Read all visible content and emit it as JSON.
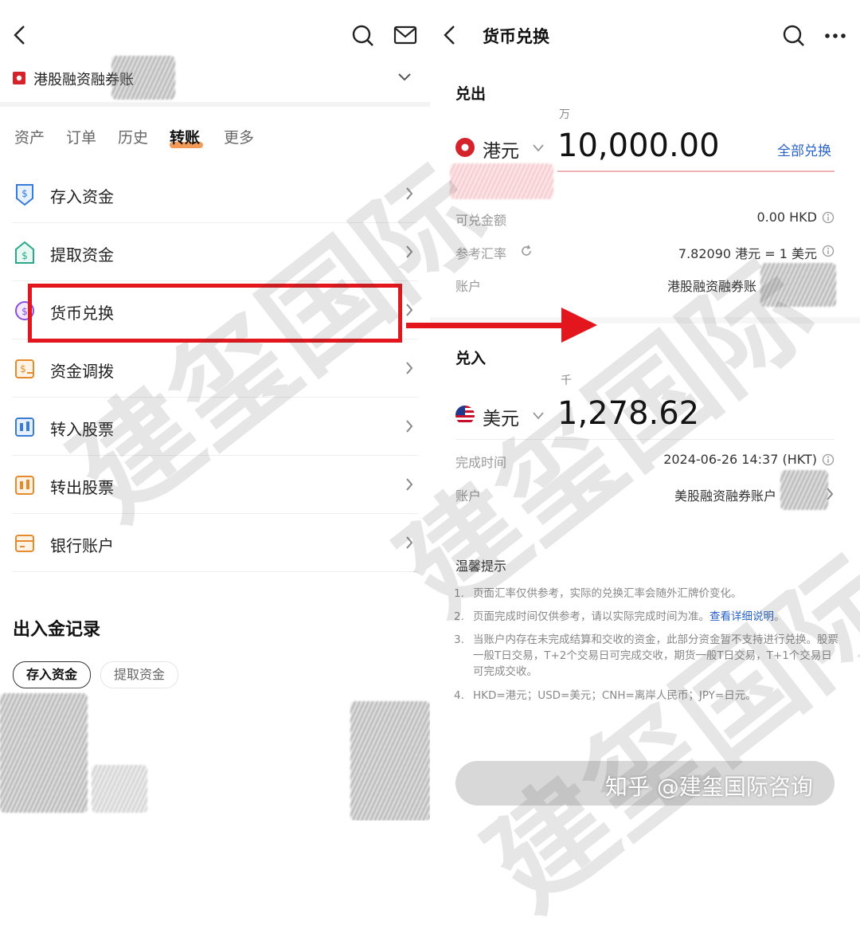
{
  "left": {
    "account_name": "港股融资融券账",
    "tabs": [
      "资产",
      "订单",
      "历史",
      "转账",
      "更多"
    ],
    "active_tab": "转账",
    "menu": [
      {
        "label": "存入资金",
        "icon": "deposit-icon"
      },
      {
        "label": "提取资金",
        "icon": "withdraw-icon"
      },
      {
        "label": "货币兑换",
        "icon": "currency-exchange-icon"
      },
      {
        "label": "资金调拨",
        "icon": "fund-transfer-icon"
      },
      {
        "label": "转入股票",
        "icon": "stock-transfer-in-icon"
      },
      {
        "label": "转出股票",
        "icon": "stock-transfer-out-icon"
      },
      {
        "label": "银行账户",
        "icon": "bank-account-icon"
      }
    ],
    "records_title": "出入金记录",
    "record_filters": [
      "存入资金",
      "提取资金"
    ]
  },
  "right": {
    "title": "货币兑换",
    "sell": {
      "section": "兑出",
      "unit_hint": "万",
      "currency": "港元",
      "amount": "10,000.00",
      "exchange_all": "全部兑换",
      "available_label": "可兑金额",
      "available_value": "0.00 HKD",
      "rate_label": "参考汇率",
      "rate_value": "7.82090 港元 = 1 美元",
      "account_label": "账户",
      "account_value": "港股融资融券账"
    },
    "buy": {
      "section": "兑入",
      "unit_hint": "千",
      "currency": "美元",
      "amount": "1,278.62",
      "time_label": "完成时间",
      "time_value": "2024-06-26 14:37 (HKT)",
      "account_label": "账户",
      "account_value": "美股融资融券账户"
    },
    "tips_title": "温馨提示",
    "tips": [
      {
        "num": "1.",
        "text": "页面汇率仅供参考，实际的兑换汇率会随外汇牌价变化。"
      },
      {
        "num": "2.",
        "text": "页面完成时间仅供参考，请以实际完成时间为准。",
        "link": "查看详细说明",
        "end": "。"
      },
      {
        "num": "3.",
        "text": "当账户内存在未完成结算和交收的资金，此部分资金暂不支持进行兑换。股票一般T日交易，T+2个交易日可完成交收，期货一般T日交易，T+1个交易日可完成交收。"
      },
      {
        "num": "4.",
        "text": "HKD=港元；USD=美元；CNH=离岸人民币；JPY=日元。"
      }
    ]
  },
  "watermark": {
    "text": "建玺国际",
    "footer": "知乎 @建玺国际咨询"
  },
  "colors": {
    "accent_red": "#e3161e",
    "link_blue": "#2b63c8",
    "highlight_orange": "#f08a3c"
  }
}
